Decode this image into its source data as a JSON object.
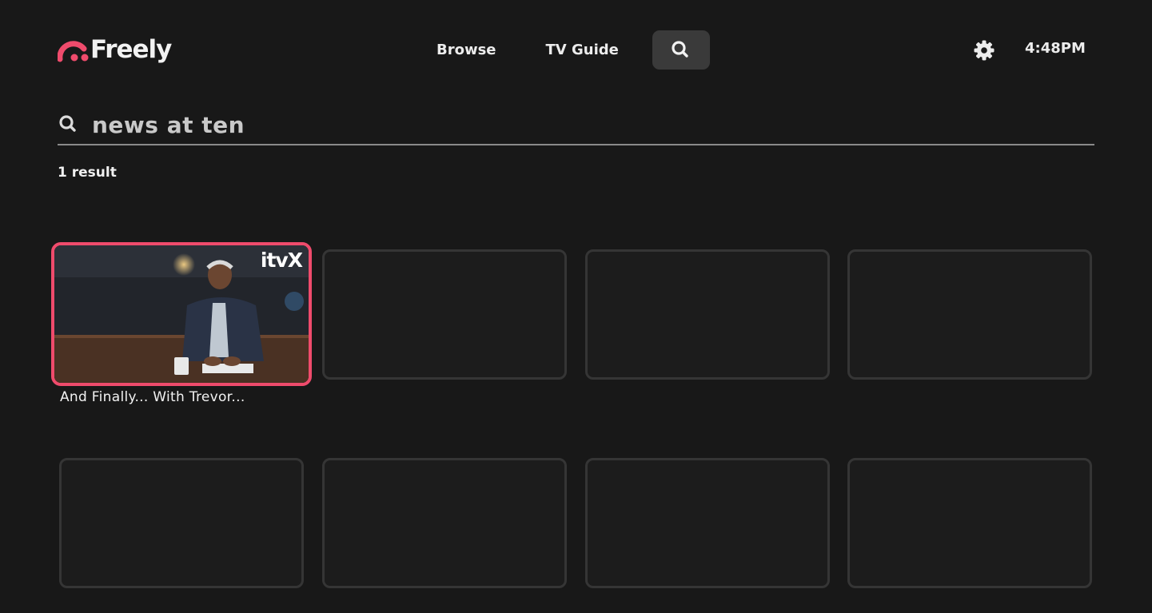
{
  "header": {
    "logo_text": "Freely",
    "brand_color": "#ef4b6c",
    "nav": [
      {
        "label": "Browse"
      },
      {
        "label": "TV Guide"
      }
    ],
    "search_icon": "search-icon",
    "settings_icon": "gear-icon",
    "clock": "4:48PM"
  },
  "search": {
    "value": "news at ten",
    "icon": "search-icon"
  },
  "results": {
    "count_label": "1 result",
    "items": [
      {
        "title": "And Finally... With Trevor...",
        "channel_badge": "itvX",
        "focused": true
      }
    ]
  },
  "colors": {
    "background": "#181818",
    "focus_border": "#ef4b6c",
    "placeholder_border": "#353535"
  }
}
